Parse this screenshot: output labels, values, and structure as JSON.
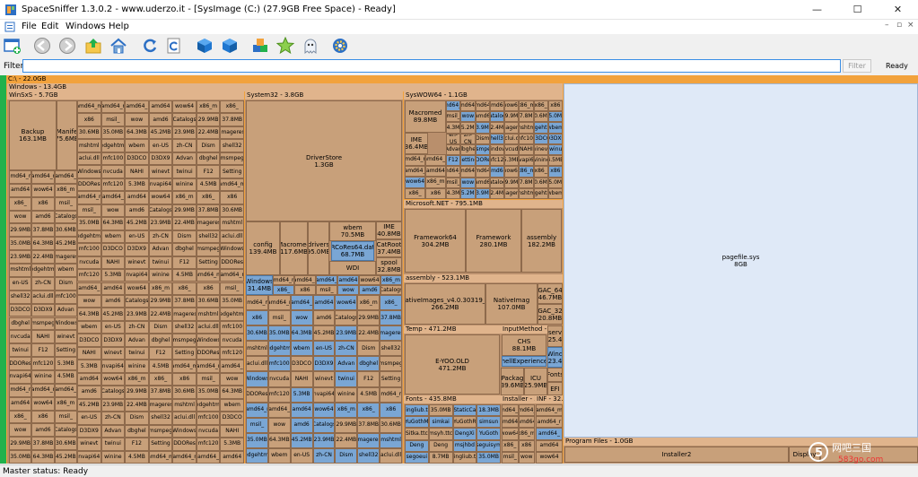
{
  "window": {
    "title": "SpaceSniffer 1.3.0.2 - www.uderzo.it - [SysImage (C:) (27.9GB Free Space) - Ready]",
    "minimize": "—",
    "maximize": "☐",
    "close": "✕"
  },
  "menu": {
    "items": [
      "File",
      "Edit",
      "Windows",
      "Help"
    ],
    "mdi_min": "–",
    "mdi_max": "▫",
    "mdi_close": "×"
  },
  "toolbar": {
    "icons": [
      "new-scan-icon",
      "back-icon",
      "forward-icon",
      "up-folder-icon",
      "home-icon",
      "refresh-icon",
      "refresh-all-icon",
      "blue-cube-icon",
      "blue-cube-2-icon",
      "cubes-tag-icon",
      "star-icon",
      "ghost-icon",
      "settings-icon"
    ]
  },
  "filter": {
    "label": "Filter",
    "value": "",
    "button": "Filter",
    "status": "Ready"
  },
  "treemap": {
    "root": "C:\\ - 22.0GB",
    "windows": "Windows - 13.4GB",
    "winsxs": "WinSxS - 5.7GB",
    "system32": "System32 - 3.8GB",
    "syswow64": "SysWOW64 - 1.1GB",
    "microsoft_net": "Microsoft.NET - 795.1MB",
    "assembly": "assembly - 523.1MB",
    "temp": "Temp - 471.2MB",
    "inputmethod": "InputMethod - 9",
    "fonts": "Fonts - 435.8MB",
    "installer": "Installer - 3",
    "inf": "INF - 32.9",
    "program_files": "Program Files - 1.0GB",
    "boxes": {
      "backup": [
        "Backup",
        "163.1MB"
      ],
      "manifests": [
        "Manife",
        "75.6MB"
      ],
      "driverstore": [
        "DriverStore",
        "1.3GB"
      ],
      "config": [
        "config",
        "139.4MB"
      ],
      "macromed32": [
        "Macromed",
        "117.6MB"
      ],
      "drivers": [
        "drivers",
        "95.0MB"
      ],
      "wbem": [
        "wbem",
        "70.5MB"
      ],
      "rcores": [
        "RCoRes64.dat",
        "68.7MB"
      ],
      "wdi": [
        "WDI",
        ""
      ],
      "ime32": [
        "IME",
        "40.8MB"
      ],
      "catroot": [
        "CatRoot",
        "37.4MB"
      ],
      "spool": [
        "spool",
        "32.8MB"
      ],
      "macromed64": [
        "Macromed",
        "89.8MB"
      ],
      "ime64": [
        "IME",
        "36.4MB"
      ],
      "framework64": [
        "Framework64",
        "304.2MB"
      ],
      "framework": [
        "Framework",
        "280.1MB"
      ],
      "assembly_net": [
        "assembly",
        "182.2MB"
      ],
      "nativeimages": [
        "NativeImages_v4.0.30319_6",
        "266.2MB"
      ],
      "nativeimag2": [
        "NativeImag",
        "107.0MB"
      ],
      "gac64": [
        "GAC_64",
        "46.7MB"
      ],
      "gac32": [
        "GAC_32",
        "20.8MB"
      ],
      "eyoo": [
        "E-YOO.OLD",
        "471.2MB"
      ],
      "chs": [
        "CHS",
        "88.1MB"
      ],
      "shellexp": [
        "ShellExperiences",
        ""
      ],
      "serv": [
        "serv",
        "25.4"
      ],
      "wind": [
        "Wind",
        "23.4"
      ],
      "packages": [
        "Packag",
        "39.6MB"
      ],
      "icu": [
        "ICU",
        "25.9MB"
      ],
      "fonts2": [
        "Fonts",
        ""
      ],
      "efi": [
        "EFI",
        ""
      ],
      "winsxs_windows": [
        "Windows",
        "31.4MB"
      ],
      "pagefile": [
        "pagefile.sys",
        "8GB"
      ],
      "installer2": [
        "Installer2",
        ""
      ],
      "display": [
        "Display",
        ""
      ]
    },
    "small_labels": [
      "amd64_m",
      "amd64_r",
      "amd64_",
      "amd64",
      "wow64",
      "x86_m",
      "x86_",
      "x86",
      "msil_",
      "wow",
      "amd6",
      "Catalogs",
      "29.9MB",
      "37.8MB",
      "30.6MB",
      "35.0MB",
      "64.3MB",
      "45.2MB",
      "23.9MB",
      "22.4MB",
      "imageres",
      "mshtml",
      "edgehtml",
      "wbem",
      "en-US",
      "zh-CN",
      "Dism",
      "shell32",
      "aclui.dll",
      "mfc100",
      "D3DCO",
      "D3DX9",
      "Advan",
      "dbghel",
      "msmpeg",
      "Windows",
      "nvcuda",
      "NAHI",
      "winevt",
      "twinui",
      "F12",
      "Setting",
      "DDORes",
      "mfc120",
      "5.3MB",
      "nvapi64",
      "winine",
      "4.5MB"
    ],
    "fonts_labels": [
      "mingliub.ttc",
      "35.0MB",
      "StaticCa",
      "18.3MB",
      "YuGothM",
      "simkai",
      "YuGothR",
      "simsun",
      "Sitka.ttc",
      "msyh.ttc",
      "DengXi",
      "YuGoth",
      "Deng",
      "Deng",
      "msjhbd",
      "seguisym",
      "segoeui",
      "8.7MB"
    ]
  },
  "statusbar": {
    "text": "Master status: Ready"
  },
  "watermark": {
    "text": "网吧三国",
    "url": "583go.com"
  },
  "colors": {
    "map_orange": "#f2a23c",
    "tan": "#c8a07a",
    "blue": "#7aa6d4",
    "green": "#22b14c",
    "pagefile_bg": "#dfe9f7"
  }
}
